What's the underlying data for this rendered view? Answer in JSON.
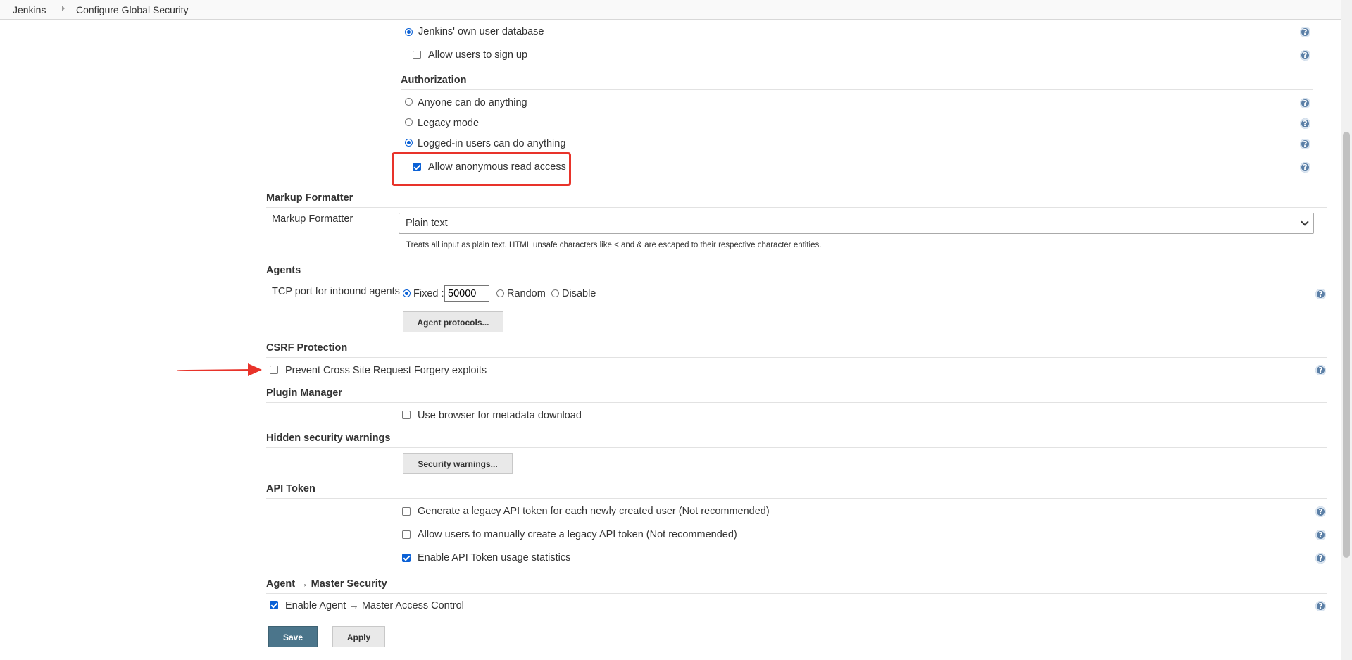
{
  "breadcrumb": {
    "items": [
      "Jenkins",
      "Configure Global Security"
    ]
  },
  "security_realm": {
    "jenkins_db_label": "Jenkins' own user database",
    "allow_signup_label": "Allow users to sign up"
  },
  "authorization": {
    "title": "Authorization",
    "options": [
      "Anyone can do anything",
      "Legacy mode",
      "Logged-in users can do anything"
    ],
    "selected": "Logged-in users can do anything",
    "anonymous_read_label": "Allow anonymous read access",
    "anonymous_read_checked": true
  },
  "markup_formatter": {
    "title": "Markup Formatter",
    "field_label": "Markup Formatter",
    "selected": "Plain text",
    "description": "Treats all input as plain text. HTML unsafe characters like < and & are escaped to their respective character entities."
  },
  "agents": {
    "title": "Agents",
    "tcp_label": "TCP port for inbound agents",
    "fixed_label": "Fixed :",
    "port_value": "50000",
    "random_label": "Random",
    "disable_label": "Disable",
    "protocols_button": "Agent protocols..."
  },
  "csrf": {
    "title": "CSRF Protection",
    "prevent_label": "Prevent Cross Site Request Forgery exploits",
    "prevent_checked": false
  },
  "plugin_manager": {
    "title": "Plugin Manager",
    "browser_metadata_label": "Use browser for metadata download"
  },
  "hidden_warnings": {
    "title": "Hidden security warnings",
    "button": "Security warnings..."
  },
  "api_token": {
    "title": "API Token",
    "legacy_each_user_label": "Generate a legacy API token for each newly created user (Not recommended)",
    "manual_legacy_label": "Allow users to manually create a legacy API token (Not recommended)",
    "usage_stats_label": "Enable API Token usage statistics"
  },
  "agent_master": {
    "title": "Agent → Master Security",
    "access_control_label": "Enable Agent → Master Access Control"
  },
  "actions": {
    "save": "Save",
    "apply": "Apply"
  },
  "colors": {
    "primary_button": "#4b758b",
    "highlight": "#e8332a",
    "checkbox_accent": "#0b61d6"
  }
}
